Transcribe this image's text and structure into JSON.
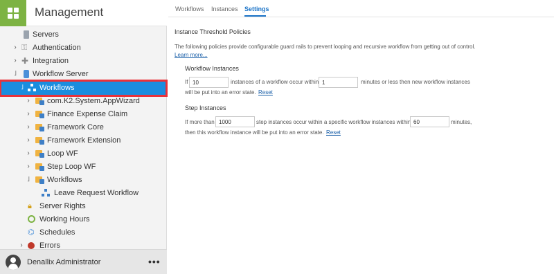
{
  "app": {
    "title": "Management"
  },
  "tree": {
    "servers": "Servers",
    "authentication": "Authentication",
    "integration": "Integration",
    "workflow_server": "Workflow Server",
    "workflows": "Workflows",
    "appwizard": "com.K2.System.AppWizard",
    "finance": "Finance Expense Claim",
    "framework_core": "Framework Core",
    "framework_extension": "Framework Extension",
    "loop_wf": "Loop WF",
    "step_loop_wf": "Step Loop WF",
    "workflows_folder": "Workflows",
    "leave_request": "Leave Request Workflow",
    "server_rights": "Server Rights",
    "working_hours": "Working Hours",
    "schedules": "Schedules",
    "errors": "Errors"
  },
  "footer": {
    "user": "Denallix Administrator",
    "more": "•••"
  },
  "tabs": {
    "workflows": "Workflows",
    "instances": "Instances",
    "settings": "Settings"
  },
  "settings": {
    "title": "Instance Threshold Policies",
    "description": "The following policies provide configurable guard rails to prevent looping and recursive workflow from getting out of control.",
    "learn_more": "Learn more...",
    "workflow_instances": {
      "title": "Workflow Instances",
      "if": "If",
      "count_value": "10",
      "mid": "instances of a workflow occur within",
      "minutes_value": "1",
      "after": "minutes or less then new workflow instances",
      "line2": "will be put into an error state.",
      "reset": "Reset"
    },
    "step_instances": {
      "title": "Step Instances",
      "if": "If more than",
      "count_value": "1000",
      "mid": "step instances occur within a specific workflow instances within",
      "minutes_value": "60",
      "after": "minutes,",
      "line2": "then this workflow instance will be put into an error state.",
      "reset": "Reset"
    }
  }
}
